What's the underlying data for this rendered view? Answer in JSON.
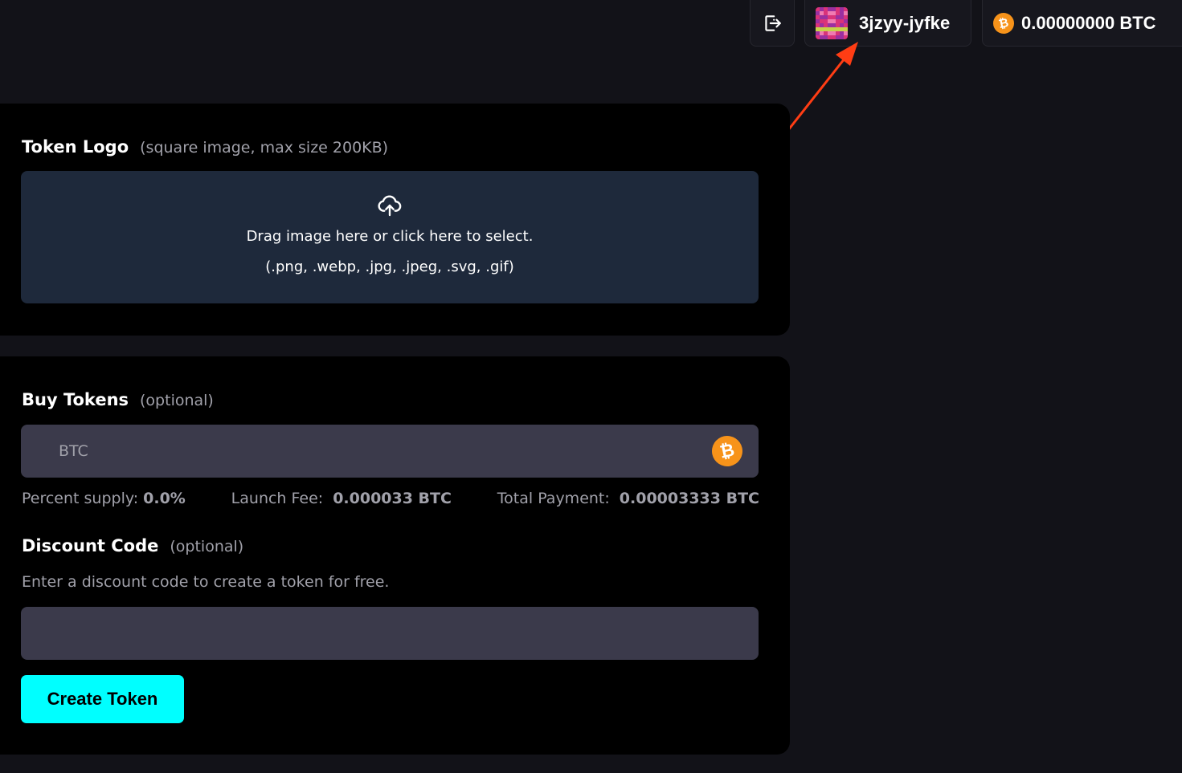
{
  "header": {
    "logout_icon": "logout-icon",
    "user": {
      "name": "3jzyy-jyfke"
    },
    "balance": {
      "text": "0.00000000 BTC",
      "coin_icon": "bitcoin-icon",
      "coin_symbol": "₿"
    }
  },
  "token_logo": {
    "title": "Token Logo",
    "hint": "(square image, max size 200KB)",
    "dropzone": {
      "icon": "cloud-upload-icon",
      "line1": "Drag image here or click here to select.",
      "line2": "(.png, .webp, .jpg, .jpeg, .svg, .gif)"
    }
  },
  "buy_tokens": {
    "title": "Buy Tokens",
    "hint": "(optional)",
    "input_placeholder": "BTC",
    "coin_symbol": "₿",
    "stats": {
      "percent_label": "Percent supply:",
      "percent_value": "0.0%",
      "fee_label": "Launch Fee:",
      "fee_value": "0.000033 BTC",
      "total_label": "Total Payment:",
      "total_value": "0.00003333 BTC"
    }
  },
  "discount": {
    "title": "Discount Code",
    "hint": "(optional)",
    "description": "Enter a discount code to create a token for free.",
    "input_value": ""
  },
  "create_button": {
    "label": "Create Token"
  },
  "colors": {
    "accent_cyan": "#00ffff",
    "bitcoin_orange": "#f7931a",
    "annotation_arrow": "#ff3d14",
    "dropzone_bg": "#1e293b",
    "input_bg": "#3b3a4b"
  }
}
